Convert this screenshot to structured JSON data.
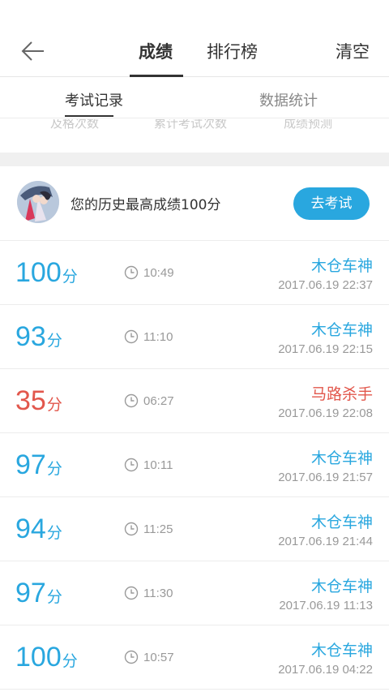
{
  "header": {
    "tabs": [
      {
        "label": "成绩",
        "active": true
      },
      {
        "label": "排行榜",
        "active": false
      }
    ],
    "clear_label": "清空"
  },
  "subtabs": [
    {
      "label": "考试记录",
      "active": true
    },
    {
      "label": "数据统计",
      "active": false
    }
  ],
  "stats_labels": [
    "及格次数",
    "累计考试次数",
    "成绩预测"
  ],
  "best": {
    "text": "您的历史最高成绩100分",
    "button_label": "去考试"
  },
  "unit": "分",
  "records": [
    {
      "score": "100",
      "duration": "10:49",
      "nickname": "木仓车神",
      "datetime": "2017.06.19  22:37",
      "color": "blue"
    },
    {
      "score": "93",
      "duration": "11:10",
      "nickname": "木仓车神",
      "datetime": "2017.06.19  22:15",
      "color": "blue"
    },
    {
      "score": "35",
      "duration": "06:27",
      "nickname": "马路杀手",
      "datetime": "2017.06.19  22:08",
      "color": "red"
    },
    {
      "score": "97",
      "duration": "10:11",
      "nickname": "木仓车神",
      "datetime": "2017.06.19  21:57",
      "color": "blue"
    },
    {
      "score": "94",
      "duration": "11:25",
      "nickname": "木仓车神",
      "datetime": "2017.06.19  21:44",
      "color": "blue"
    },
    {
      "score": "97",
      "duration": "11:30",
      "nickname": "木仓车神",
      "datetime": "2017.06.19  11:13",
      "color": "blue"
    },
    {
      "score": "100",
      "duration": "10:57",
      "nickname": "木仓车神",
      "datetime": "2017.06.19  04:22",
      "color": "blue"
    }
  ],
  "colors": {
    "accent": "#29a7df",
    "fail": "#e2574c"
  }
}
